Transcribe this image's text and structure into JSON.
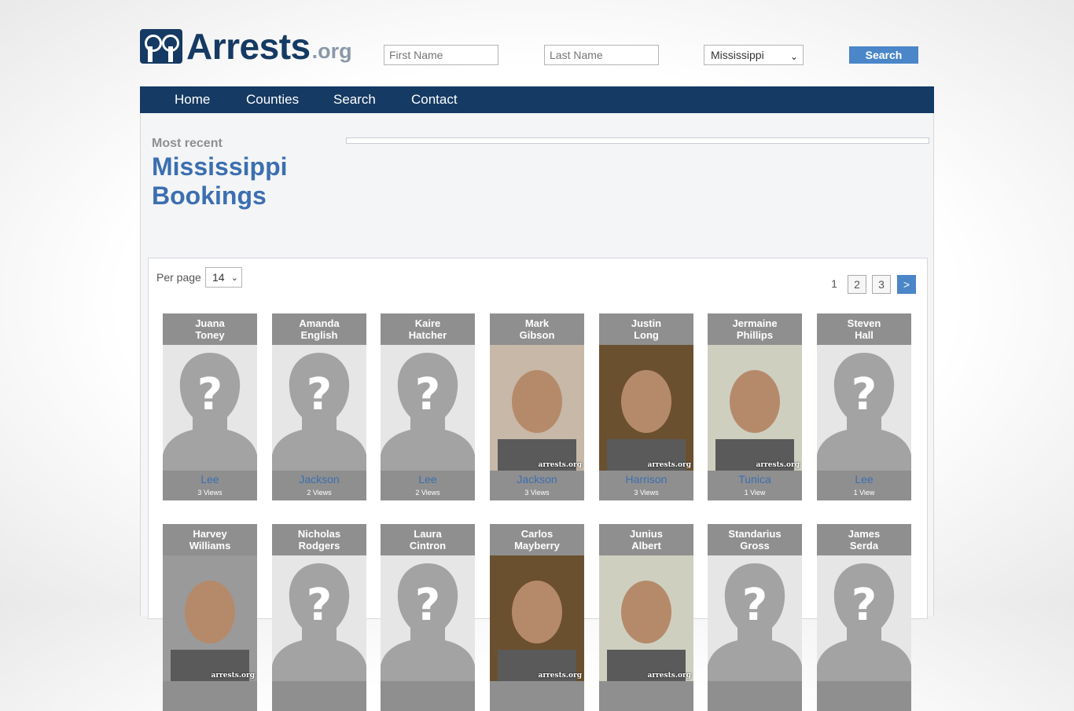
{
  "header": {
    "logo_text": "Arrests",
    "logo_tld": ".org",
    "first_name_placeholder": "First Name",
    "last_name_placeholder": "Last Name",
    "state_selected": "Mississippi",
    "search_label": "Search"
  },
  "nav": {
    "items": [
      "Home",
      "Counties",
      "Search",
      "Contact"
    ]
  },
  "intro": {
    "most_recent": "Most recent",
    "title_line1": "Mississippi",
    "title_line2": "Bookings"
  },
  "listing": {
    "per_page_label": "Per page",
    "per_page_value": "14",
    "pagination": [
      "1",
      "2",
      "3",
      ">"
    ],
    "watermark": "arrests.org",
    "cards": [
      {
        "first": "Juana",
        "last": "Toney",
        "county": "Lee",
        "views": "3 Views",
        "photo": "placeholder"
      },
      {
        "first": "Amanda",
        "last": "English",
        "county": "Jackson",
        "views": "2 Views",
        "photo": "placeholder"
      },
      {
        "first": "Kaire",
        "last": "Hatcher",
        "county": "Lee",
        "views": "2 Views",
        "photo": "placeholder"
      },
      {
        "first": "Mark",
        "last": "Gibson",
        "county": "Jackson",
        "views": "3 Views",
        "photo": "mugshot"
      },
      {
        "first": "Justin",
        "last": "Long",
        "county": "Harrison",
        "views": "3 Views",
        "photo": "mugshot"
      },
      {
        "first": "Jermaine",
        "last": "Phillips",
        "county": "Tunica",
        "views": "1 View",
        "photo": "mugshot"
      },
      {
        "first": "Steven",
        "last": "Hall",
        "county": "Lee",
        "views": "1 View",
        "photo": "placeholder"
      },
      {
        "first": "Harvey",
        "last": "Williams",
        "county": "",
        "views": "",
        "photo": "mugshot"
      },
      {
        "first": "Nicholas",
        "last": "Rodgers",
        "county": "",
        "views": "",
        "photo": "placeholder"
      },
      {
        "first": "Laura",
        "last": "Cintron",
        "county": "",
        "views": "",
        "photo": "placeholder"
      },
      {
        "first": "Carlos",
        "last": "Mayberry",
        "county": "",
        "views": "",
        "photo": "mugshot"
      },
      {
        "first": "Junius",
        "last": "Albert",
        "county": "",
        "views": "",
        "photo": "mugshot"
      },
      {
        "first": "Standarius",
        "last": "Gross",
        "county": "",
        "views": "",
        "photo": "placeholder"
      },
      {
        "first": "James",
        "last": "Serda",
        "county": "",
        "views": "",
        "photo": "placeholder"
      }
    ]
  },
  "colors": {
    "brand_navy": "#153a63",
    "accent_blue": "#3b6fb0",
    "button_blue": "#4a86c8",
    "card_gray": "#8f8f8f"
  }
}
